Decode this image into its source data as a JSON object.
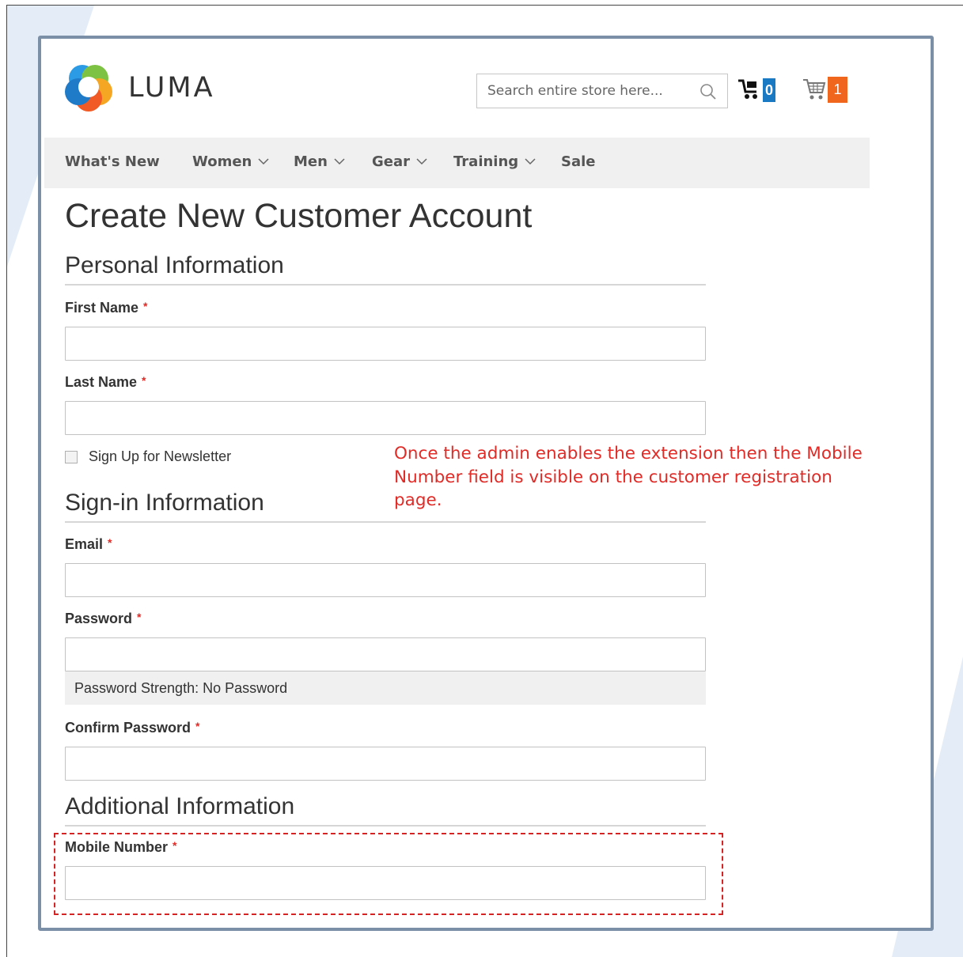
{
  "brand": {
    "name": "LUMA"
  },
  "header": {
    "search_placeholder": "Search entire store here...",
    "compare_count": "0",
    "cart_count": "1",
    "colors": {
      "compare_badge": "#1979c3",
      "cart_badge": "#f1661d"
    }
  },
  "nav": {
    "items": [
      {
        "label": "What's New",
        "has_dropdown": false
      },
      {
        "label": "Women",
        "has_dropdown": true
      },
      {
        "label": "Men",
        "has_dropdown": true
      },
      {
        "label": "Gear",
        "has_dropdown": true
      },
      {
        "label": "Training",
        "has_dropdown": true
      },
      {
        "label": "Sale",
        "has_dropdown": false
      }
    ]
  },
  "page": {
    "title": "Create New Customer Account"
  },
  "personal": {
    "heading": "Personal Information",
    "first_name_label": "First Name",
    "last_name_label": "Last Name",
    "newsletter_label": "Sign Up for Newsletter",
    "newsletter_checked": false
  },
  "signin": {
    "heading": "Sign-in Information",
    "email_label": "Email",
    "password_label": "Password",
    "password_strength": "Password Strength: No Password",
    "confirm_label": "Confirm Password"
  },
  "additional": {
    "heading": "Additional Information",
    "mobile_label": "Mobile Number"
  },
  "required_marker": "*",
  "annotation": {
    "text": "Once the admin enables the extension then the Mobile Number field is visible on the customer registration page.",
    "color": "#e02b27"
  }
}
